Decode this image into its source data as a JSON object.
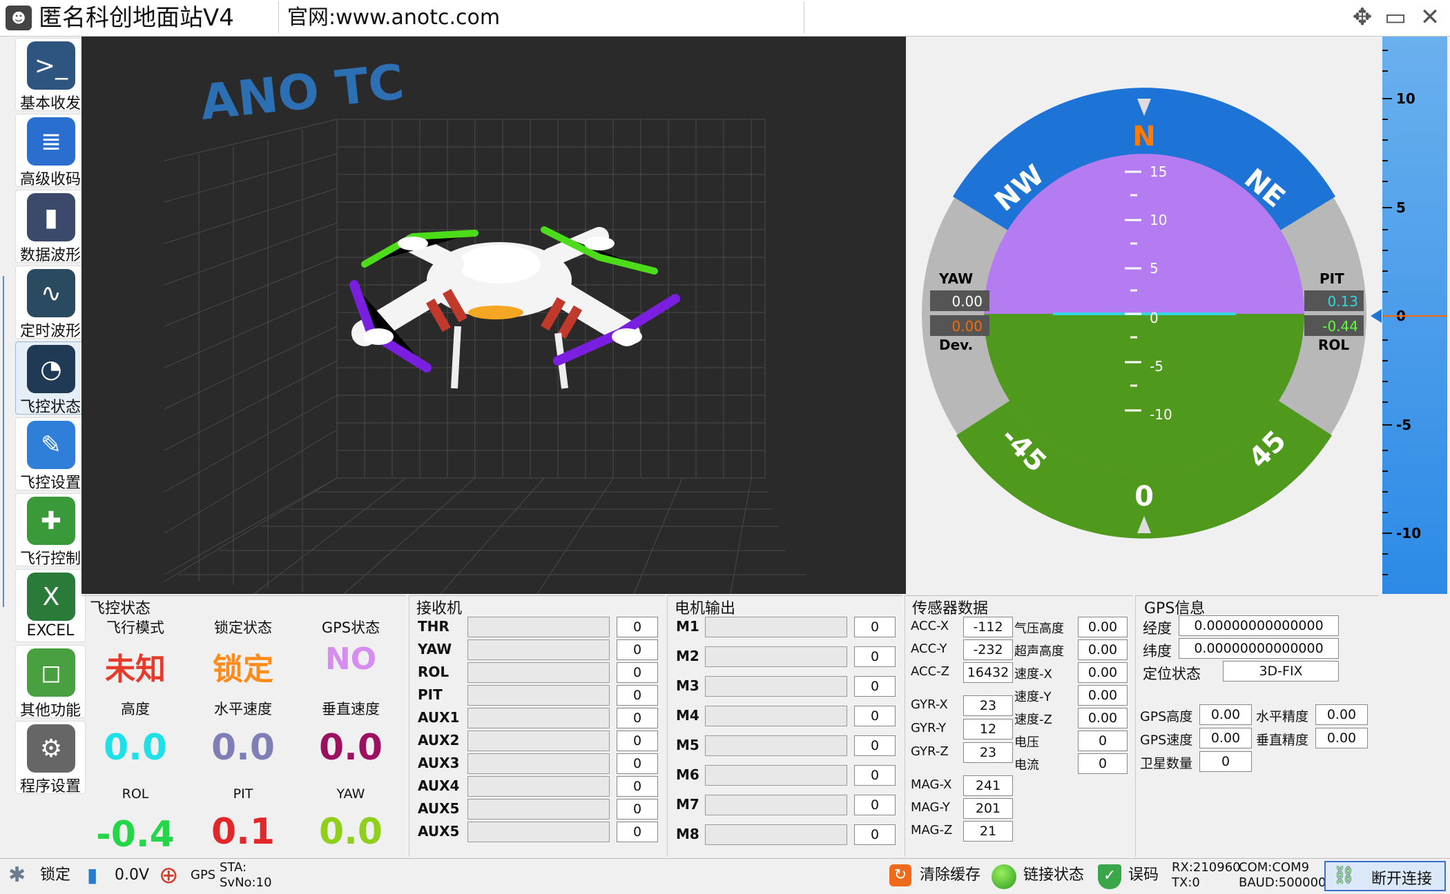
{
  "app": {
    "title": "匿名科创地面站V4",
    "site": "官网:www.anotc.com"
  },
  "nav": [
    {
      "label": "基本收发",
      "color": "#2d5580",
      "glyph": ">_"
    },
    {
      "label": "高级收码",
      "color": "#2a6fd0",
      "glyph": "≣"
    },
    {
      "label": "数据波形",
      "color": "#3b4a6a",
      "glyph": "▮"
    },
    {
      "label": "定时波形",
      "color": "#2a4a60",
      "glyph": "∿"
    },
    {
      "label": "飞控状态",
      "color": "#203a55",
      "glyph": "◔"
    },
    {
      "label": "飞控设置",
      "color": "#2f7fd8",
      "glyph": "✎"
    },
    {
      "label": "飞行控制",
      "color": "#3a9a3a",
      "glyph": "✚"
    },
    {
      "label": "EXCEL",
      "color": "#2a7a3a",
      "glyph": "X"
    },
    {
      "label": "其他功能",
      "color": "#49a040",
      "glyph": "◻"
    },
    {
      "label": "程序设置",
      "color": "#666666",
      "glyph": "⚙"
    }
  ],
  "view3d": {
    "logo": "ANO TC"
  },
  "hud": {
    "yaw_label": "YAW",
    "yaw_value": "0.00",
    "dev_value": "0.00",
    "dev_label": "Dev.",
    "pit_label": "PIT",
    "pit_value": "0.13",
    "rol_value": "-0.44",
    "rol_label": "ROL",
    "compass": [
      "N",
      "NE",
      "NW"
    ],
    "roll_marks": [
      "-45",
      "45",
      "0"
    ],
    "pitch_ticks": [
      "15",
      "10",
      "5",
      "0",
      "-5",
      "-10"
    ],
    "colors": {
      "sky": "#b47cf0",
      "ground": "#4f9a1c",
      "ring_blue": "#1e73d6",
      "ring_grey": "#b8b8b8"
    }
  },
  "altitude_ticks": [
    "10",
    "5",
    "0",
    "-5",
    "-10"
  ],
  "flight_status": {
    "title": "飞控状态",
    "mode_label": "飞行模式",
    "mode_value": "未知",
    "lock_label": "锁定状态",
    "lock_value": "锁定",
    "gps_label": "GPS状态",
    "gps_value": "NO",
    "alt_label": "高度",
    "alt_value": "0.0",
    "hspeed_label": "水平速度",
    "hspeed_value": "0.0",
    "vspeed_label": "垂直速度",
    "vspeed_value": "0.0",
    "rol_label": "ROL",
    "rol_value": "-0.4",
    "pit_label": "PIT",
    "pit_value": "0.1",
    "yaw_label": "YAW",
    "yaw_value": "0.0"
  },
  "receiver": {
    "title": "接收机",
    "channels": [
      {
        "name": "THR",
        "value": "0"
      },
      {
        "name": "YAW",
        "value": "0"
      },
      {
        "name": "ROL",
        "value": "0"
      },
      {
        "name": "PIT",
        "value": "0"
      },
      {
        "name": "AUX1",
        "value": "0"
      },
      {
        "name": "AUX2",
        "value": "0"
      },
      {
        "name": "AUX3",
        "value": "0"
      },
      {
        "name": "AUX4",
        "value": "0"
      },
      {
        "name": "AUX5",
        "value": "0"
      },
      {
        "name": "AUX5",
        "value": "0"
      }
    ]
  },
  "motors": {
    "title": "电机输出",
    "items": [
      {
        "name": "M1",
        "value": "0"
      },
      {
        "name": "M2",
        "value": "0"
      },
      {
        "name": "M3",
        "value": "0"
      },
      {
        "name": "M4",
        "value": "0"
      },
      {
        "name": "M5",
        "value": "0"
      },
      {
        "name": "M6",
        "value": "0"
      },
      {
        "name": "M7",
        "value": "0"
      },
      {
        "name": "M8",
        "value": "0"
      }
    ]
  },
  "sensors": {
    "title": "传感器数据",
    "acc": [
      {
        "name": "ACC-X",
        "value": "-112"
      },
      {
        "name": "ACC-Y",
        "value": "-232"
      },
      {
        "name": "ACC-Z",
        "value": "16432"
      }
    ],
    "gyr": [
      {
        "name": "GYR-X",
        "value": "23"
      },
      {
        "name": "GYR-Y",
        "value": "12"
      },
      {
        "name": "GYR-Z",
        "value": "23"
      }
    ],
    "mag": [
      {
        "name": "MAG-X",
        "value": "241"
      },
      {
        "name": "MAG-Y",
        "value": "201"
      },
      {
        "name": "MAG-Z",
        "value": "21"
      }
    ],
    "other": [
      {
        "name": "气压高度",
        "value": "0.00"
      },
      {
        "name": "超声高度",
        "value": "0.00"
      },
      {
        "name": "速度-X",
        "value": "0.00"
      },
      {
        "name": "速度-Y",
        "value": "0.00"
      },
      {
        "name": "速度-Z",
        "value": "0.00"
      },
      {
        "name": "电压",
        "value": "0"
      },
      {
        "name": "电流",
        "value": "0"
      }
    ]
  },
  "gps": {
    "title": "GPS信息",
    "lon_label": "经度",
    "lon_value": "0.00000000000000",
    "lat_label": "纬度",
    "lat_value": "0.00000000000000",
    "fix_label": "定位状态",
    "fix_value": "3D-FIX",
    "alt_label": "GPS高度",
    "alt_value": "0.00",
    "hacc_label": "水平精度",
    "hacc_value": "0.00",
    "speed_label": "GPS速度",
    "speed_value": "0.00",
    "vacc_label": "垂直精度",
    "vacc_value": "0.00",
    "sat_label": "卫星数量",
    "sat_value": "0"
  },
  "statusbar": {
    "lock": "锁定",
    "voltage": "0.0V",
    "gps": "GPS",
    "sta": "STA:",
    "svno": "SvNo:10",
    "clear": "清除缓存",
    "link": "链接状态",
    "err": "误码",
    "rx": "RX:210960",
    "tx": "TX:0",
    "com": "COM:COM9",
    "baud": "BAUD:500000",
    "disconnect": "断开连接"
  }
}
